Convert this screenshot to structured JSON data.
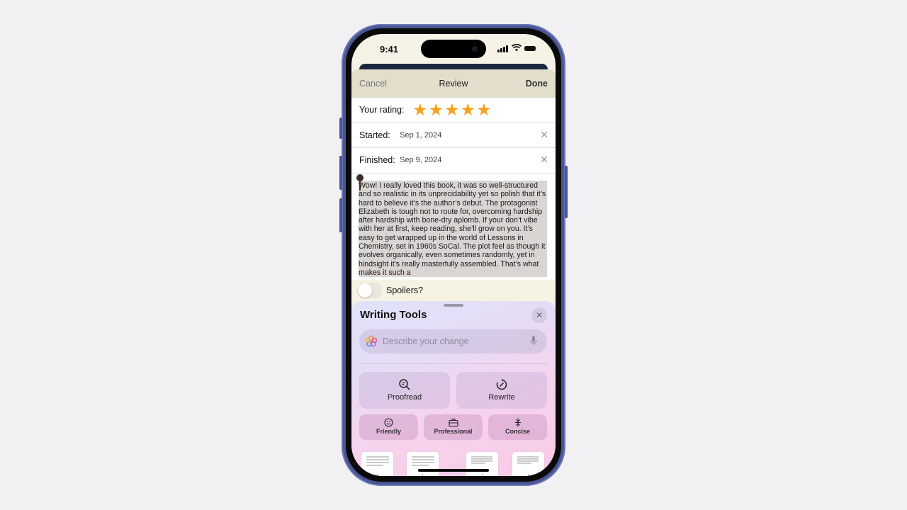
{
  "status_bar": {
    "time": "9:41"
  },
  "nav": {
    "cancel": "Cancel",
    "title": "Review",
    "done": "Done"
  },
  "rating": {
    "label": "Your rating:",
    "value": 5,
    "max": 5,
    "star_color": "#f6a11c"
  },
  "started": {
    "label": "Started:",
    "value": "Sep 1, 2024"
  },
  "finished": {
    "label": "Finished:",
    "value": "Sep 9, 2024"
  },
  "review": {
    "text": "Wow! I really loved this book, it was so well-structured and so realistic in its unprecidability yet so polish that it’s hard to believe it’s the author’s debut. The protagonist Elizabeth is tough not to route for, overcoming hardship after hardship with bone-dry aplomb. If your don’t vibe with her at first, keep reading, she’ll grow on you. It’s easy to get wrapped up in the world of Lessons in Chemistry, set in 1960s SoCal. The plot feel as though it evolves organically, even sometimes randomly, yet in hindsight it’s really masterfully assembled. That’s what makes it such a"
  },
  "spoilers": {
    "label": "Spoilers?",
    "on": false
  },
  "writing_tools": {
    "title": "Writing Tools",
    "prompt_placeholder": "Describe your change",
    "primary_actions": [
      {
        "label": "Proofread",
        "icon": "proofread-icon"
      },
      {
        "label": "Rewrite",
        "icon": "rewrite-icon"
      }
    ],
    "tone_actions": [
      {
        "label": "Friendly",
        "icon": "smiley-icon"
      },
      {
        "label": "Professional",
        "icon": "briefcase-icon"
      },
      {
        "label": "Concise",
        "icon": "compress-icon"
      }
    ],
    "format_thumbnails": 4
  }
}
